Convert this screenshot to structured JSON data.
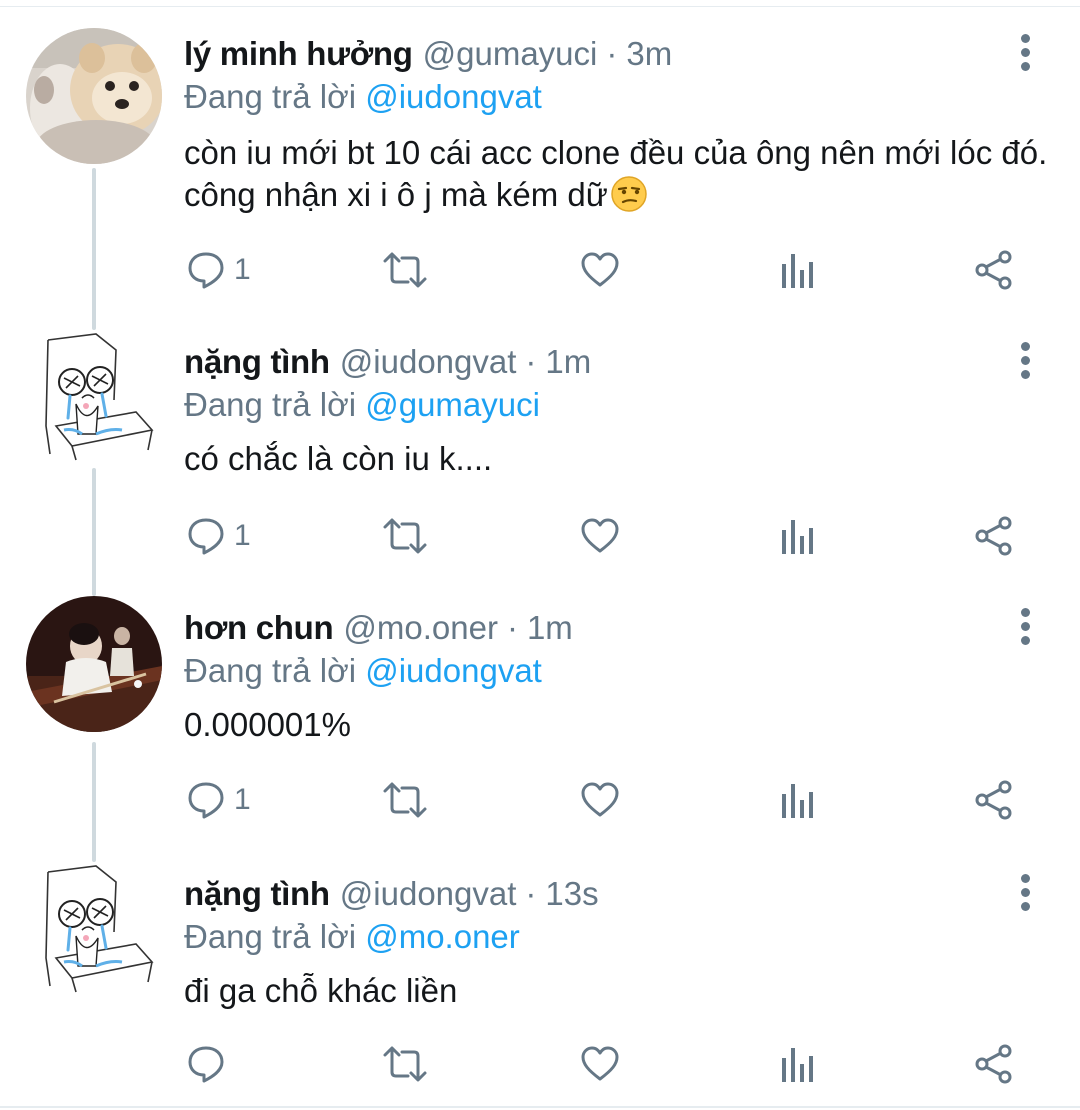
{
  "thread": [
    {
      "name": "lý minh hưởng",
      "handle": "@gumayuci",
      "separator": "·",
      "time": "3m",
      "replying_label": "Đang trả lời",
      "replying_to": "@iudongvat",
      "text": "còn iu mới bt 10 cái acc clone đều của ông nên mới lóc đó. công nhận xi i ô j mà kém dữ",
      "emoji": "unamused-face",
      "reply_count": "1",
      "avatar": "dog-photo-avatar"
    },
    {
      "name": "nặng tình",
      "handle": "@iudongvat",
      "separator": "·",
      "time": "1m",
      "replying_label": "Đang trả lời",
      "replying_to": "@gumayuci",
      "text": "có chắc là còn iu k....",
      "reply_count": "1",
      "avatar": "crying-sketch-avatar"
    },
    {
      "name": "hơn chun",
      "handle": "@mo.oner",
      "separator": "·",
      "time": "1m",
      "replying_label": "Đang trả lời",
      "replying_to": "@iudongvat",
      "text": "0.000001%",
      "reply_count": "1",
      "avatar": "billiards-photo-avatar"
    },
    {
      "name": "nặng tình",
      "handle": "@iudongvat",
      "separator": "·",
      "time": "13s",
      "replying_label": "Đang trả lời",
      "replying_to": "@mo.oner",
      "text": "đi ga chỗ khác liền",
      "reply_count": "",
      "avatar": "crying-sketch-avatar"
    }
  ],
  "icons": {
    "reply": "reply-icon",
    "retweet": "retweet-icon",
    "like": "like-icon",
    "analytics": "analytics-icon",
    "share": "share-icon",
    "more": "more-vertical-icon"
  },
  "colors": {
    "text": "#14171a",
    "secondary": "#657786",
    "link": "#1da1f2",
    "thread_line": "#cfd9de",
    "divider": "#e6ecf0"
  }
}
